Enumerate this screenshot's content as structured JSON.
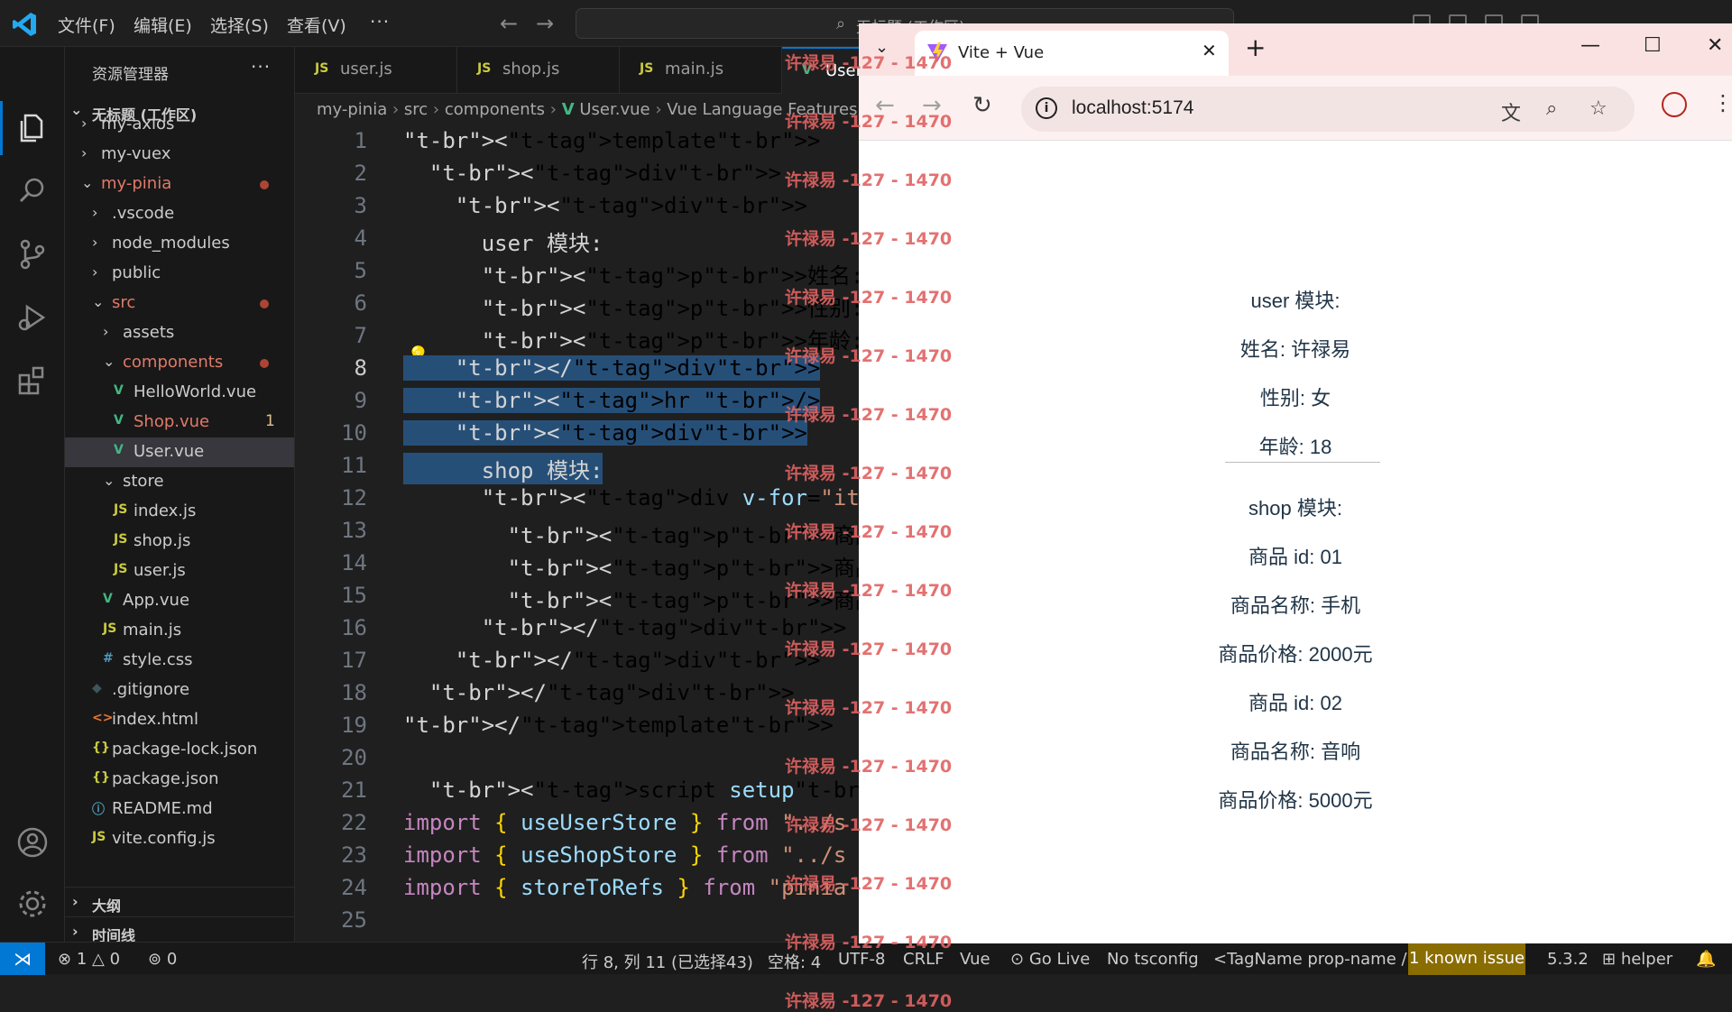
{
  "titlebar": {
    "menus": [
      "文件(F)",
      "编辑(E)",
      "选择(S)",
      "查看(V)"
    ],
    "more": "···",
    "command_center": "无标题 (工作区)"
  },
  "sidebar": {
    "title": "资源管理器",
    "more": "···",
    "workspace": "无标题 (工作区)",
    "tree": [
      {
        "label": "my-axios",
        "icon": "folder-closed",
        "git": ""
      },
      {
        "label": "my-vuex",
        "icon": "folder-closed",
        "git": ""
      },
      {
        "label": "my-pinia",
        "icon": "folder-open",
        "git": "modified"
      },
      {
        "label": ".vscode",
        "icon": "folder-closed",
        "git": ""
      },
      {
        "label": "node_modules",
        "icon": "folder-closed",
        "git": ""
      },
      {
        "label": "public",
        "icon": "folder-closed",
        "git": ""
      },
      {
        "label": "src",
        "icon": "folder-open",
        "git": "modified"
      },
      {
        "label": "assets",
        "icon": "folder-closed",
        "git": ""
      },
      {
        "label": "components",
        "icon": "folder-open",
        "git": "modified"
      },
      {
        "label": "HelloWorld.vue",
        "icon": "vue-file",
        "git": ""
      },
      {
        "label": "Shop.vue",
        "icon": "vue-file",
        "git": "1"
      },
      {
        "label": "User.vue",
        "icon": "vue-file",
        "git": ""
      },
      {
        "label": "store",
        "icon": "folder-open",
        "git": ""
      },
      {
        "label": "index.js",
        "icon": "js-file",
        "git": ""
      },
      {
        "label": "shop.js",
        "icon": "js-file",
        "git": ""
      },
      {
        "label": "user.js",
        "icon": "js-file",
        "git": ""
      },
      {
        "label": "App.vue",
        "icon": "vue-file",
        "git": ""
      },
      {
        "label": "main.js",
        "icon": "js-file",
        "git": ""
      },
      {
        "label": "style.css",
        "icon": "css-file",
        "git": ""
      },
      {
        "label": ".gitignore",
        "icon": "git-file",
        "git": ""
      },
      {
        "label": "index.html",
        "icon": "html-file",
        "git": ""
      },
      {
        "label": "package-lock.json",
        "icon": "json-file",
        "git": ""
      },
      {
        "label": "package.json",
        "icon": "json-file",
        "git": ""
      },
      {
        "label": "README.md",
        "icon": "info-file",
        "git": ""
      },
      {
        "label": "vite.config.js",
        "icon": "js-file",
        "git": ""
      }
    ],
    "sections": [
      "大纲",
      "时间线"
    ]
  },
  "editor": {
    "tabs": [
      "user.js",
      "shop.js",
      "main.js",
      "User.vue"
    ],
    "breadcrumb": [
      "my-pinia",
      "src",
      "components",
      "User.vue",
      "Vue Language Features"
    ],
    "lines": [
      "<template>",
      "  <div>",
      "    <div>",
      "      user 模块:",
      "      <p>姓名: {{ name }}</p>",
      "      <p>性别: {{ sex }}</p>",
      "      <p>年龄: {{ age }}</p>",
      "    </div>",
      "    <hr />",
      "    <div>",
      "      shop 模块:",
      "      <div v-for=\"item in list\" :k",
      "        <p>商品 id: {{ item.id }}</",
      "        <p>商品名称: {{ item.name }",
      "        <p>商品价格: {{ item.price",
      "      </div>",
      "    </div>",
      "  </div>",
      "</template>",
      "",
      "  <script setup>",
      "import { useUserStore } from \"../s",
      "import { useShopStore } from \"../s",
      "import { storeToRefs } from \"pinia",
      ""
    ]
  },
  "watermark": "许禄易 -127 - 1470",
  "browser": {
    "tab_title": "Vite + Vue",
    "url": "localhost:5174",
    "page": {
      "user_heading": "user 模块:",
      "user_lines": [
        "姓名: 许禄易",
        "性别: 女",
        "年龄: 18"
      ],
      "shop_heading": "shop 模块:",
      "shop_lines": [
        "商品 id: 01",
        "商品名称: 手机",
        "商品价格: 2000元",
        "商品 id: 02",
        "商品名称: 音响",
        "商品价格: 5000元"
      ]
    }
  },
  "statusbar": {
    "errors": "1",
    "warnings": "0",
    "ports": "0",
    "cursor": "行 8, 列 11 (已选择43)",
    "indent": "空格: 4",
    "encoding": "UTF-8",
    "eol": "CRLF",
    "language": "Vue",
    "golive": "Go Live",
    "tsconfig": "No tsconfig",
    "tagname": "<TagName prop-name />",
    "known_issue": "1 known issue",
    "version": "5.3.2",
    "helper": "helper"
  }
}
